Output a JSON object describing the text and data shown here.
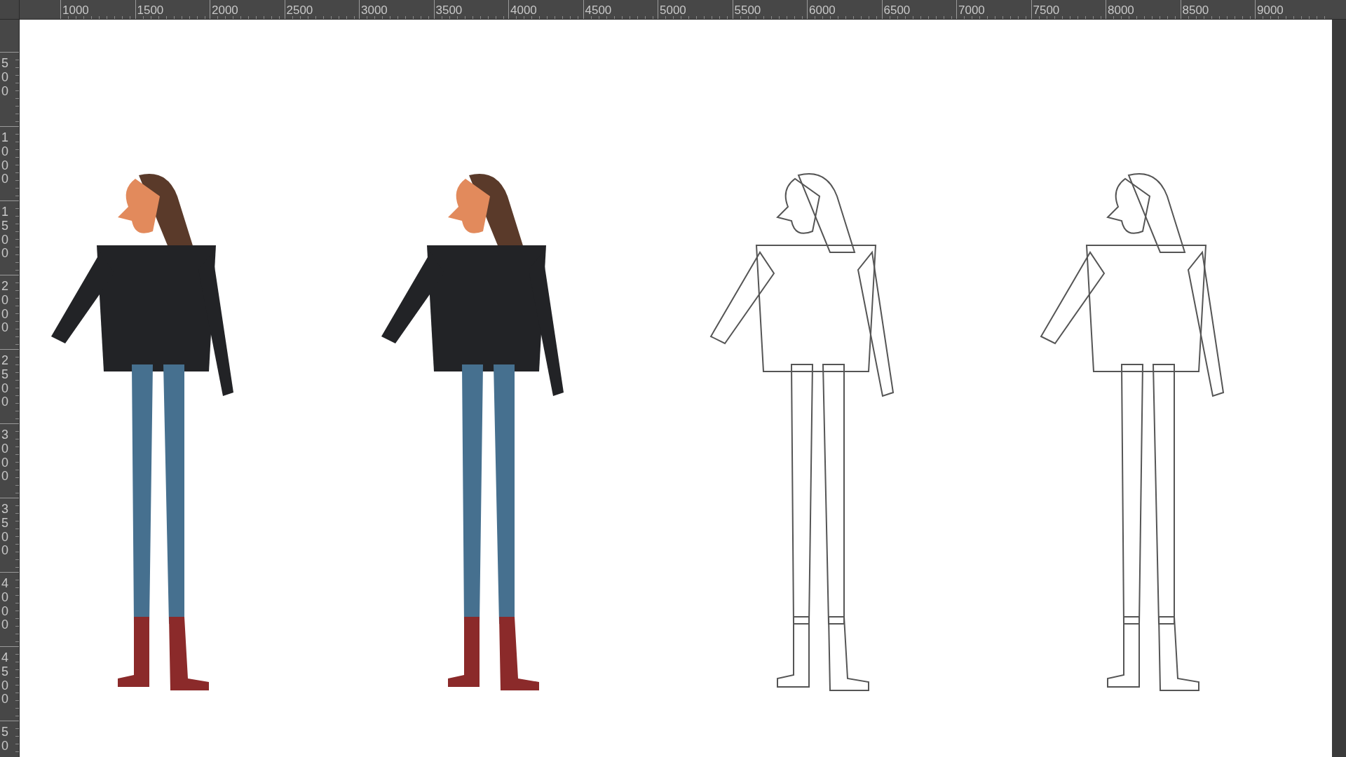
{
  "ruler_top": {
    "labels": [
      "1000",
      "1500",
      "2000",
      "2500",
      "3000",
      "3500",
      "4000",
      "4500",
      "5000",
      "5500",
      "6000",
      "6500",
      "7000",
      "7500",
      "8000",
      "8500",
      "9000"
    ]
  },
  "ruler_left": {
    "labels": [
      "500",
      "1000",
      "1500",
      "2000",
      "2500",
      "3000",
      "3500",
      "4000",
      "4500",
      "50"
    ]
  },
  "canvas": {
    "artworks": [
      {
        "kind": "colored"
      },
      {
        "kind": "colored"
      },
      {
        "kind": "sketch"
      },
      {
        "kind": "sketch"
      }
    ]
  }
}
